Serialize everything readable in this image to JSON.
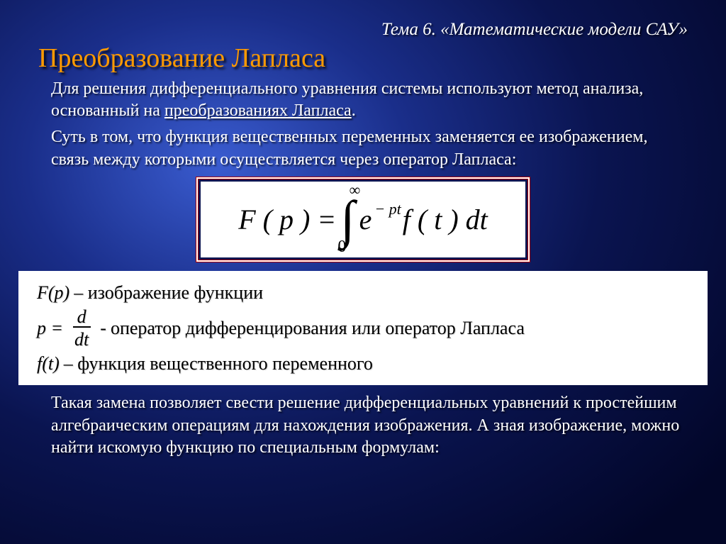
{
  "header": {
    "topic": "Тема 6. «Математические модели САУ»",
    "title": "Преобразование Лапласа"
  },
  "intro": {
    "p1_a": "Для решения дифференциального уравнения системы используют метод анализа, основанный на ",
    "p1_b": "преобразованиях Лапласа",
    "p1_c": ".",
    "p2": "Суть в том, что функция вещественных переменных заменяется ее изображением, связь между которыми осуществляется через оператор Лапласа:"
  },
  "formula": {
    "lhs": "F ( p ) = ",
    "int_upper": "∞",
    "int_lower": "0",
    "e": "e",
    "exp": "− pt",
    "ft": " f ( t ) dt"
  },
  "defs": {
    "d1_sym": "F(p)",
    "d1_txt": " – изображение функции",
    "d2_pre": "p = ",
    "d2_num": "d",
    "d2_den": "dt",
    "d2_dash": " - ",
    "d2_txt": "оператор дифференцирования или оператор Лапласа",
    "d3_sym": "f(t)",
    "d3_txt": " – функция вещественного переменного"
  },
  "outro": {
    "p3": "Такая замена позволяет свести решение дифференциальных уравнений к простейшим алгебраическим операциям для нахождения изображения. А зная изображение, можно найти искомую функцию по специальным формулам:"
  }
}
